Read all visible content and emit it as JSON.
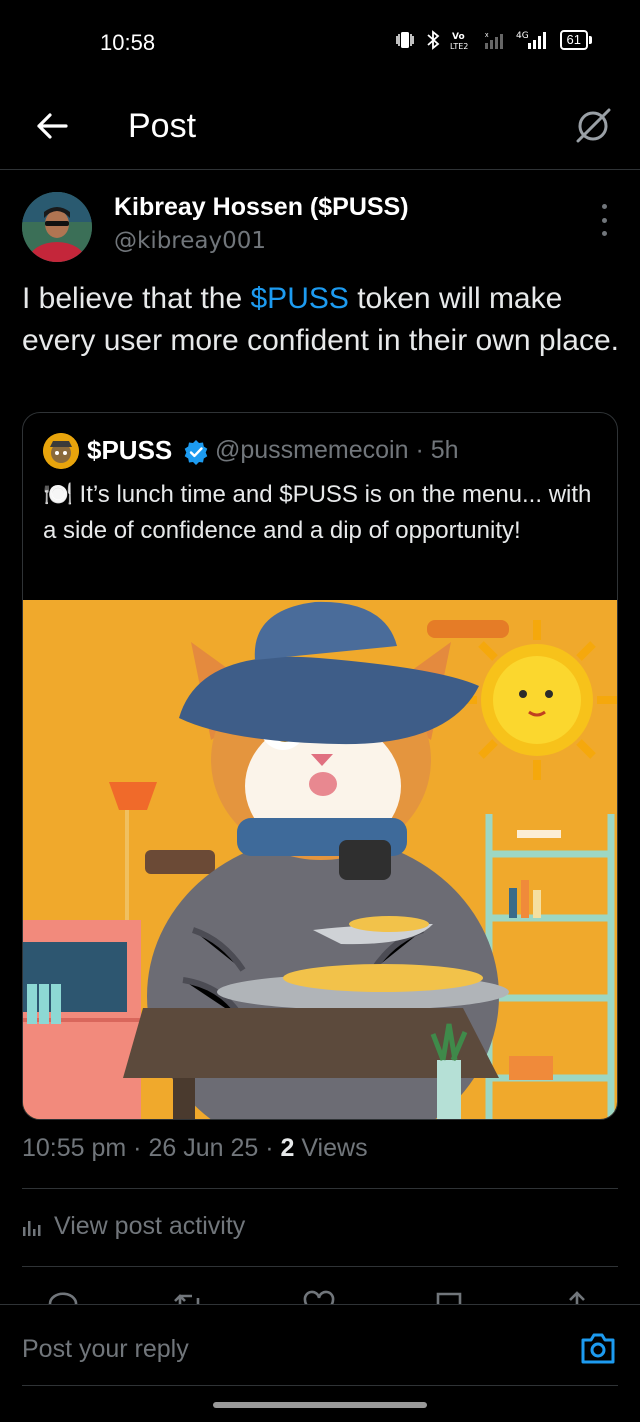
{
  "status_bar": {
    "time": "10:58",
    "network": "4G",
    "battery": "61",
    "icons": [
      "vibrate-icon",
      "bluetooth-icon",
      "volte-icon",
      "signal-icon",
      "battery-icon"
    ]
  },
  "header": {
    "title": "Post"
  },
  "post": {
    "author_name": "Kibreay Hossen ($PUSS)",
    "author_handle": "@kibreay001",
    "text_before": "I believe that the ",
    "cashtag": "$PUSS",
    "text_after": " token will make every user more confident in their own place.",
    "timestamp": "10:55 pm · 26 Jun 25 · ",
    "views_count": "2",
    "views_label": " Views"
  },
  "quote": {
    "name": "$PUSS",
    "handle_time": "@pussmemecoin · 5h",
    "text": "🍽️ It’s lunch time and $PUSS is on the menu... with a side of confidence and a dip of opportunity!",
    "image_alt": "cartoon cat in blue hat eating at a table"
  },
  "activity": {
    "label": "View post activity"
  },
  "reply": {
    "placeholder": "Post your reply"
  },
  "colors": {
    "background": "#000000",
    "accent": "#1d9bf0",
    "secondary_text": "#71767b",
    "divider": "#2f3336"
  }
}
